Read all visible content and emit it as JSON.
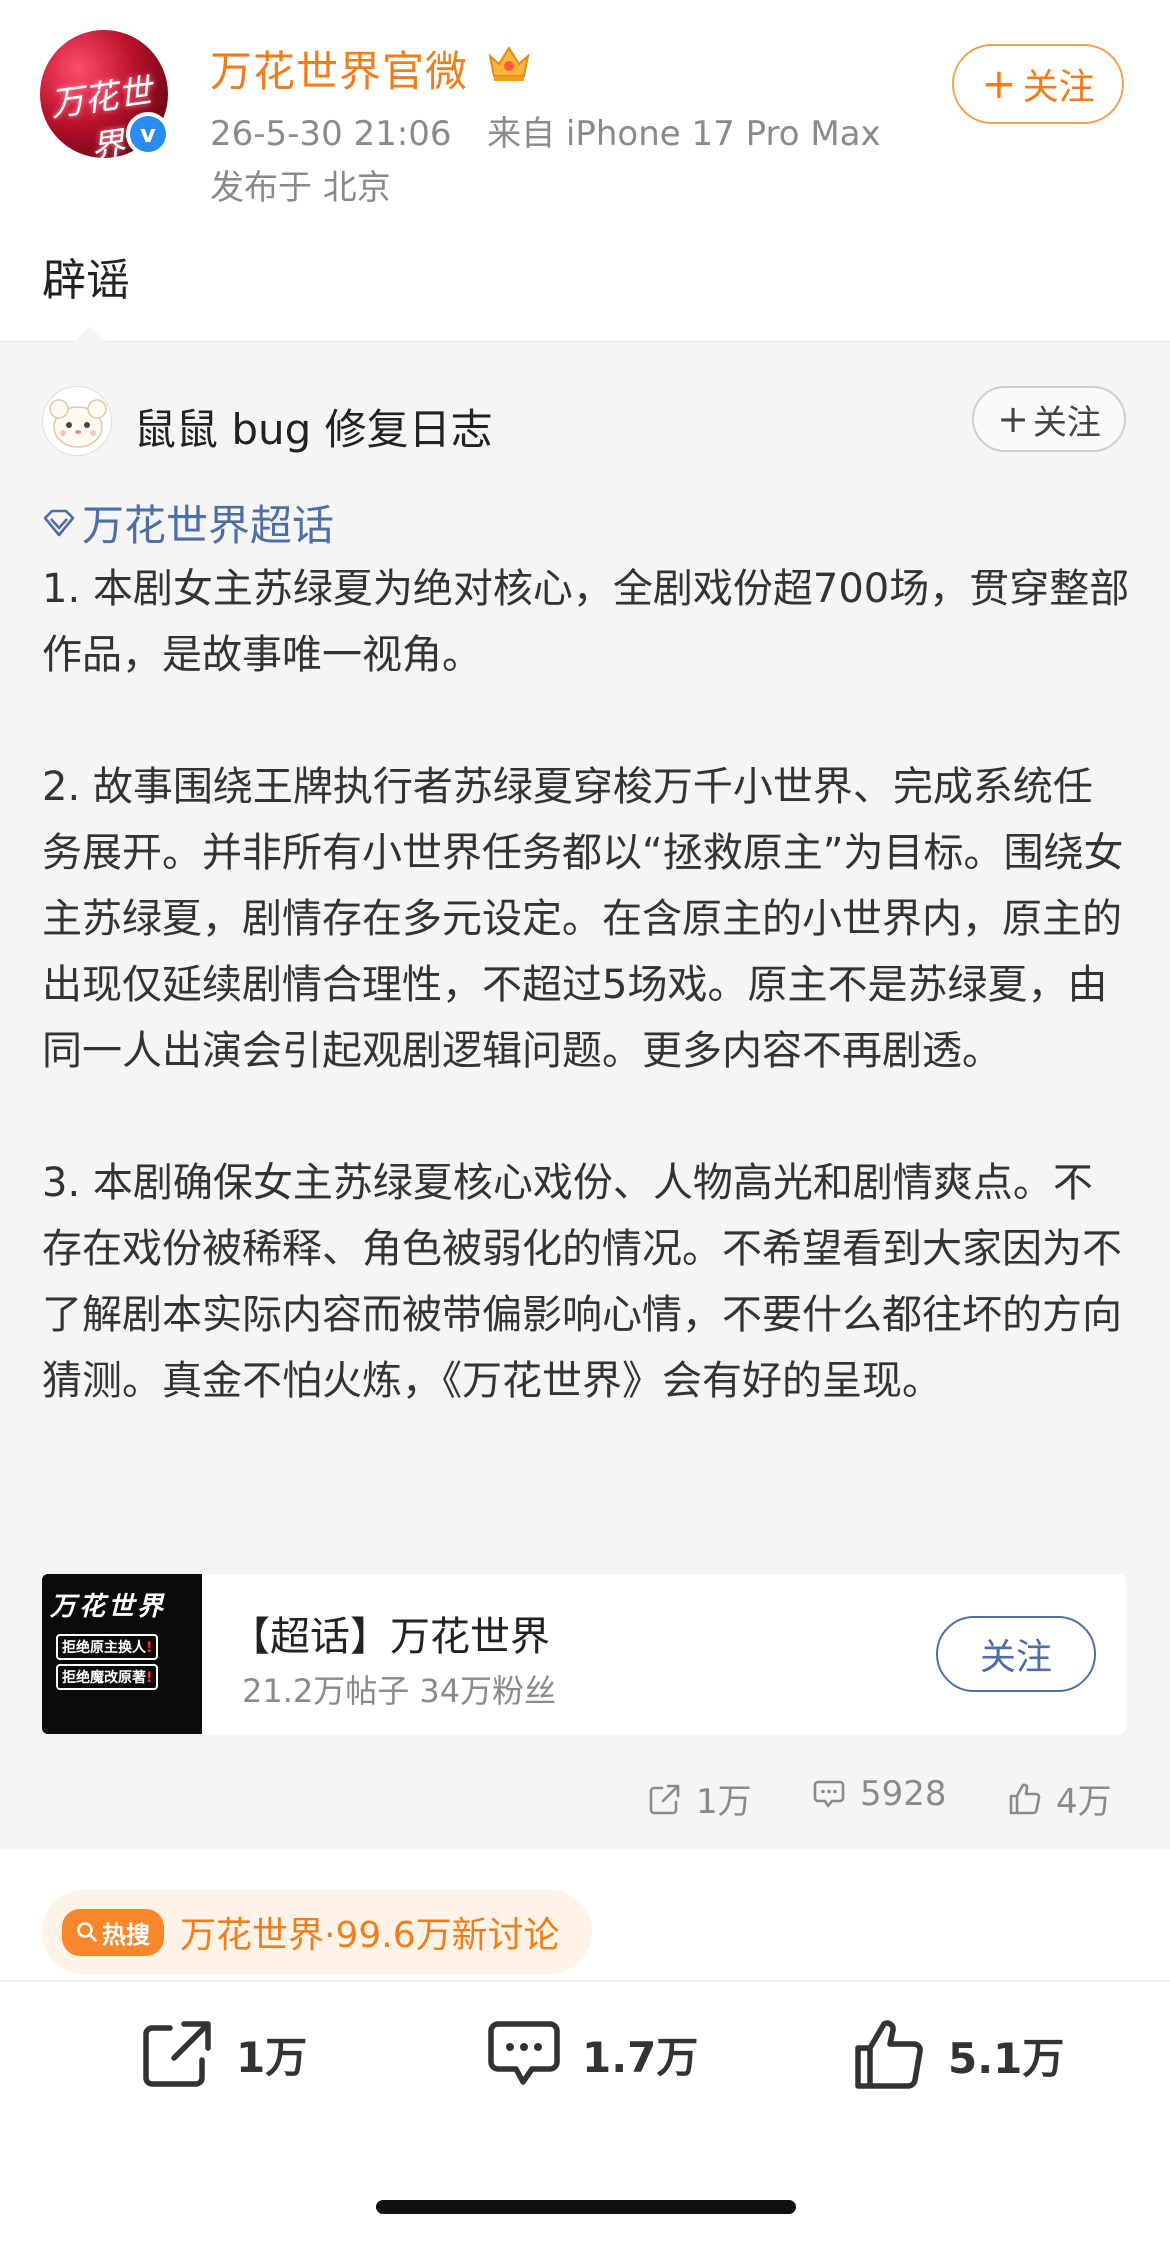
{
  "post": {
    "author_name": "万花世界官微",
    "avatar_text": "万花世界",
    "timestamp": "26-5-30 21:06",
    "source": "来自 iPhone 17 Pro Max",
    "location": "发布于 北京",
    "follow_label": "关注",
    "text": "辟谣"
  },
  "repost": {
    "author_name": "鼠鼠 bug 修复日志",
    "follow_label": "关注",
    "topic_link": "万花世界超话",
    "paragraphs": [
      "1. 本剧女主苏绿夏为绝对核心，全剧戏份超700场，贯穿整部作品，是故事唯一视角。",
      "2. 故事围绕王牌执行者苏绿夏穿梭万千小世界、完成系统任务展开。并非所有小世界任务都以“拯救原主”为目标。围绕女主苏绿夏，剧情存在多元设定。在含原主的小世界内，原主的出现仅延续剧情合理性，不超过5场戏。原主不是苏绿夏，由同一人出演会引起观剧逻辑问题。更多内容不再剧透。",
      "3. 本剧确保女主苏绿夏核心戏份、人物高光和剧情爽点。不存在戏份被稀释、角色被弱化的情况。不希望看到大家因为不了解剧本实际内容而被带偏影响心情，不要什么都往坏的方向猜测。真金不怕火炼，《万花世界》会有好的呈现。"
    ],
    "topic_card": {
      "thumb_title": "万花世界",
      "thumb_line1": "拒绝原主换人",
      "thumb_line2": "拒绝魔改原著",
      "thumb_mark": "!",
      "title": "【超话】万花世界",
      "stats": "21.2万帖子 34万粉丝",
      "follow_label": "关注"
    },
    "stats": {
      "reposts": "1万",
      "comments": "5928",
      "likes": "4万"
    }
  },
  "hot_search": {
    "badge": "热搜",
    "text": "万花世界·99.6万新讨论"
  },
  "action_bar": {
    "share": "1万",
    "comment": "1.7万",
    "like": "5.1万"
  },
  "colors": {
    "accent_orange": "#f07c1a",
    "link_blue": "#4e6ea5",
    "verified_blue": "#2a8cf0"
  }
}
